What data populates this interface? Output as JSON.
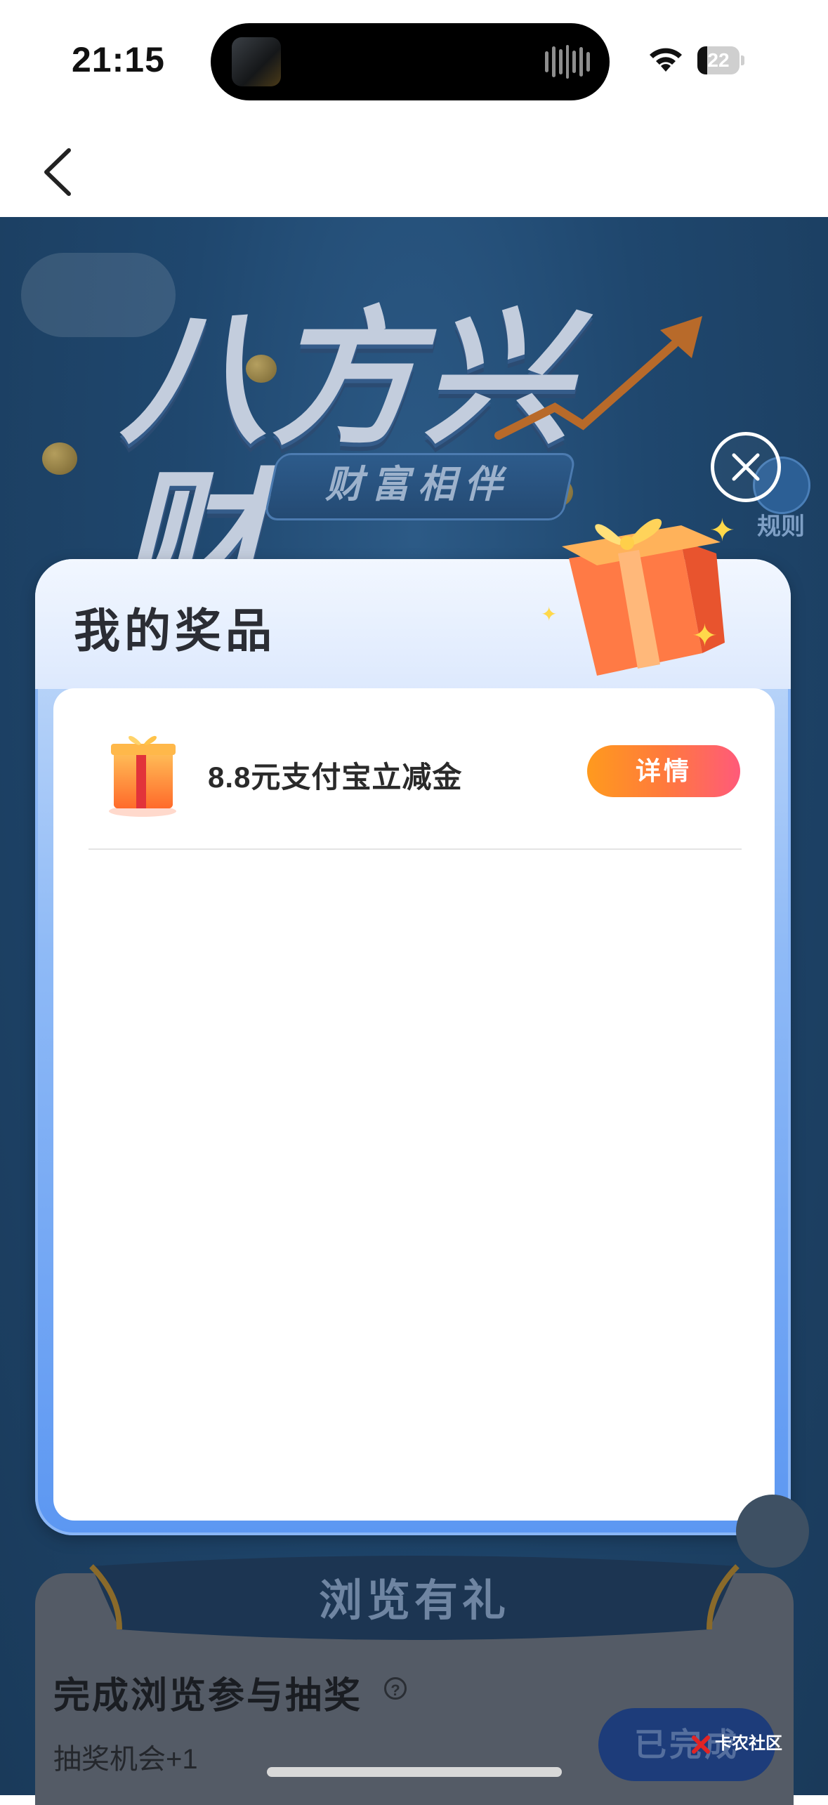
{
  "status_bar": {
    "time": "21:15",
    "battery": "22"
  },
  "nav": {
    "back_icon": "chevron-left-icon"
  },
  "banner": {
    "title": "八方兴财",
    "subtitle": "财富相伴"
  },
  "rules": {
    "label": "规则"
  },
  "modal": {
    "title": "我的奖品",
    "close_icon": "close-icon",
    "prizes": [
      {
        "name": "8.8元支付宝立减金",
        "button": "详情",
        "icon": "gift-box-icon"
      }
    ]
  },
  "browse_section": {
    "ribbon": "浏览有礼",
    "task_title": "完成浏览参与抽奖",
    "help": "?",
    "task_sub": "抽奖机会+1",
    "done_button": "已完成"
  },
  "watermark": "卡农社区",
  "colors": {
    "accent_orange": "#ff9a1e",
    "accent_pink": "#ff5a7a",
    "modal_blue": "#5c97f2",
    "page_navy": "#1f476e"
  }
}
